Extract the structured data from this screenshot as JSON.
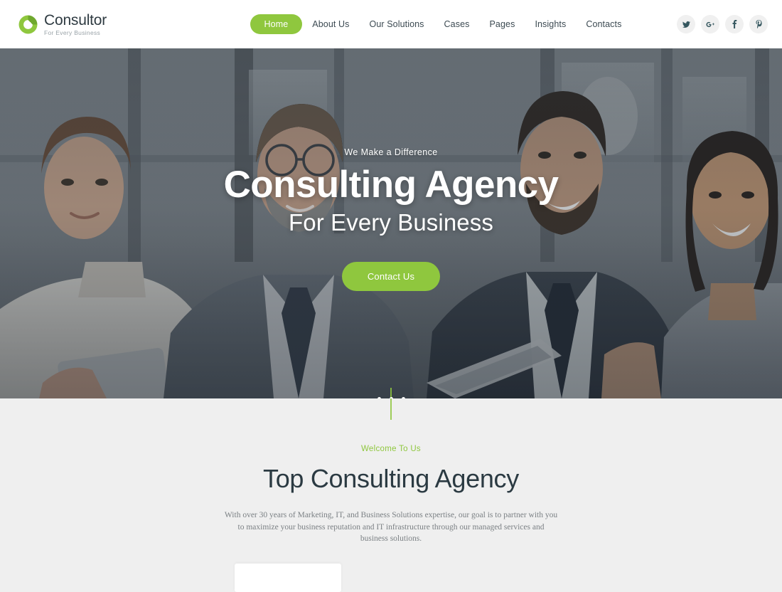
{
  "brand": {
    "name": "Consultor",
    "tagline": "For Every Business",
    "logo_icon": "circular-c-logo-icon",
    "accent_color": "#8fc73e",
    "text_color": "#2f3b42"
  },
  "header": {
    "nav": [
      {
        "label": "Home",
        "active": true
      },
      {
        "label": "About Us",
        "active": false
      },
      {
        "label": "Our Solutions",
        "active": false
      },
      {
        "label": "Cases",
        "active": false
      },
      {
        "label": "Pages",
        "active": false
      },
      {
        "label": "Insights",
        "active": false
      },
      {
        "label": "Contacts",
        "active": false
      }
    ],
    "socials": [
      {
        "name": "twitter-icon",
        "label": "Twitter"
      },
      {
        "name": "google-plus-icon",
        "label": "Google Plus"
      },
      {
        "name": "facebook-icon",
        "label": "Facebook"
      },
      {
        "name": "pinterest-icon",
        "label": "Pinterest"
      }
    ]
  },
  "hero": {
    "subtitle": "We Make a Difference",
    "title": "Consulting Agency",
    "title_secondary": "For Every Business",
    "cta_label": "Contact Us",
    "slider_dots": 3,
    "active_dot": 0,
    "overlay_color": "#2b343c"
  },
  "welcome": {
    "kicker": "Welcome To Us",
    "title": "Top Consulting Agency",
    "body": "With over 30 years of Marketing,  IT,  and Business Solutions expertise, our goal is to partner with you to maximize your business reputation and IT infrastructure through our managed services and business solutions.",
    "background_color": "#efefef"
  }
}
